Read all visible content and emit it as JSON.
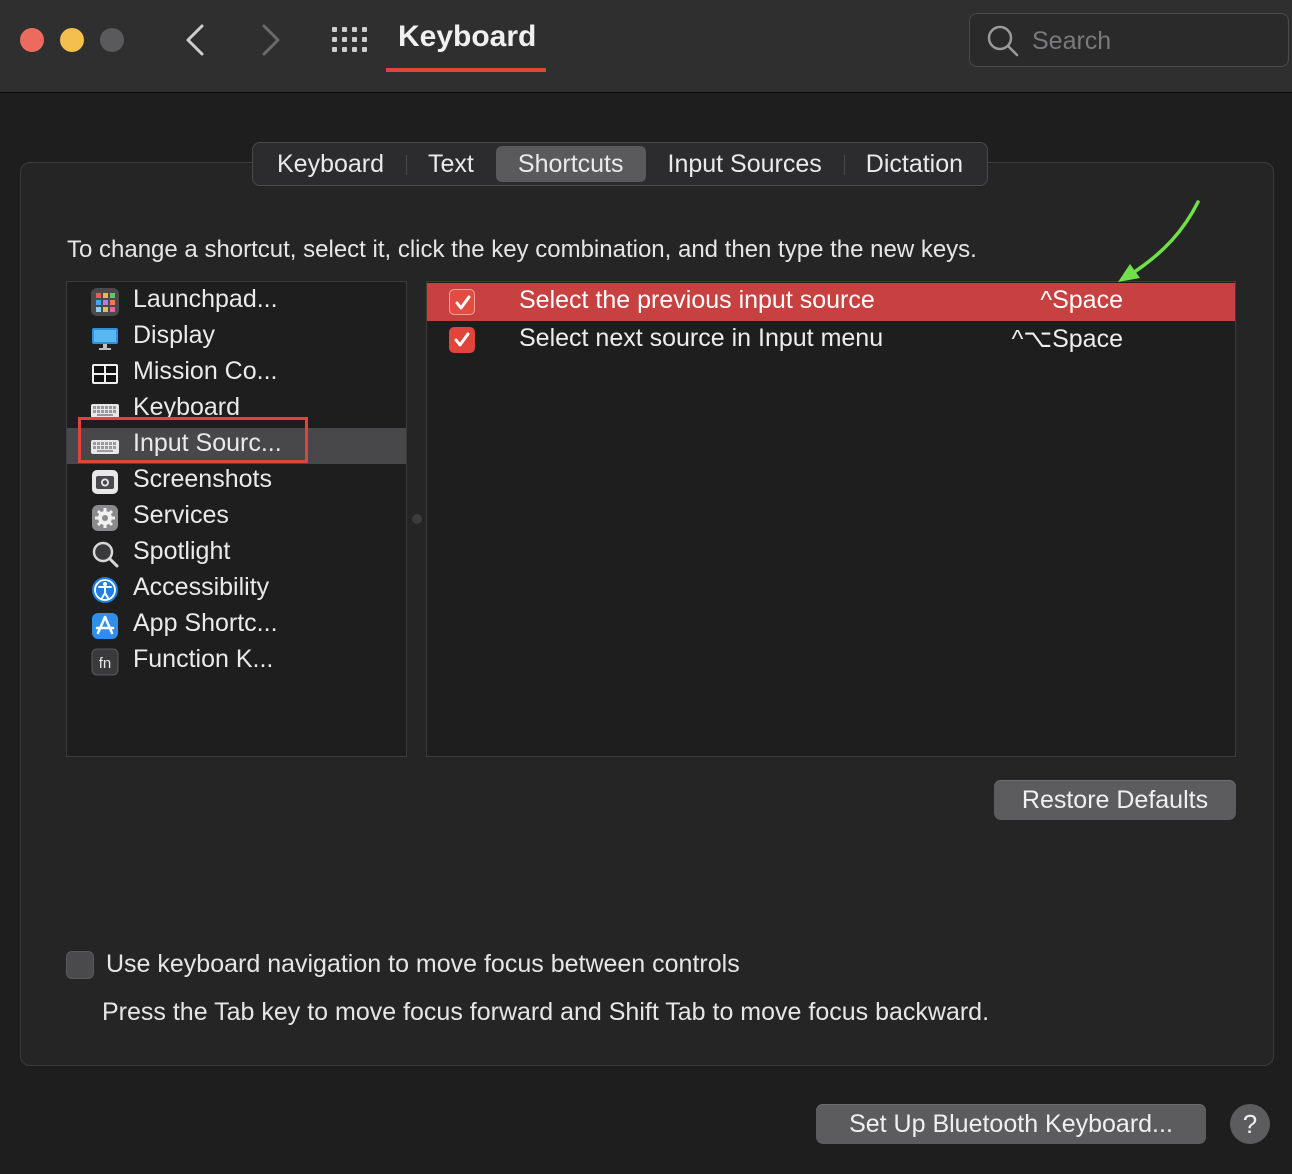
{
  "window": {
    "title": "Keyboard",
    "search_placeholder": "Search"
  },
  "tabs": [
    {
      "label": "Keyboard",
      "active": false
    },
    {
      "label": "Text",
      "active": false
    },
    {
      "label": "Shortcuts",
      "active": true
    },
    {
      "label": "Input Sources",
      "active": false
    },
    {
      "label": "Dictation",
      "active": false
    }
  ],
  "instructions": "To change a shortcut, select it, click the key combination, and then type the new keys.",
  "categories": [
    {
      "label": "Launchpad...",
      "icon": "launchpad-icon"
    },
    {
      "label": "Display",
      "icon": "display-icon"
    },
    {
      "label": "Mission Co...",
      "icon": "mission-control-icon"
    },
    {
      "label": "Keyboard",
      "icon": "keyboard-icon"
    },
    {
      "label": "Input Sourc...",
      "icon": "keyboard-icon",
      "selected": true
    },
    {
      "label": "Screenshots",
      "icon": "screenshot-icon"
    },
    {
      "label": "Services",
      "icon": "gear-icon"
    },
    {
      "label": "Spotlight",
      "icon": "magnifier-icon"
    },
    {
      "label": "Accessibility",
      "icon": "accessibility-icon"
    },
    {
      "label": "App Shortc...",
      "icon": "app-store-icon"
    },
    {
      "label": "Function K...",
      "icon": "fn-key-icon"
    }
  ],
  "shortcuts": [
    {
      "label": "Select the previous input source",
      "keys": "^Space",
      "checked": true,
      "selected": true
    },
    {
      "label": "Select next source in Input menu",
      "keys": "^⌥Space",
      "checked": true,
      "selected": false
    }
  ],
  "buttons": {
    "restore_defaults": "Restore Defaults",
    "bluetooth": "Set Up Bluetooth Keyboard...",
    "help": "?"
  },
  "keyboard_navigation": {
    "label": "Use keyboard navigation to move focus between controls",
    "checked": false,
    "help_text": "Press the Tab key to move focus forward and Shift Tab to move focus backward."
  },
  "colors": {
    "accent": "#e0443a",
    "selection": "#c84141",
    "annotation_arrow": "#6fe04a"
  }
}
